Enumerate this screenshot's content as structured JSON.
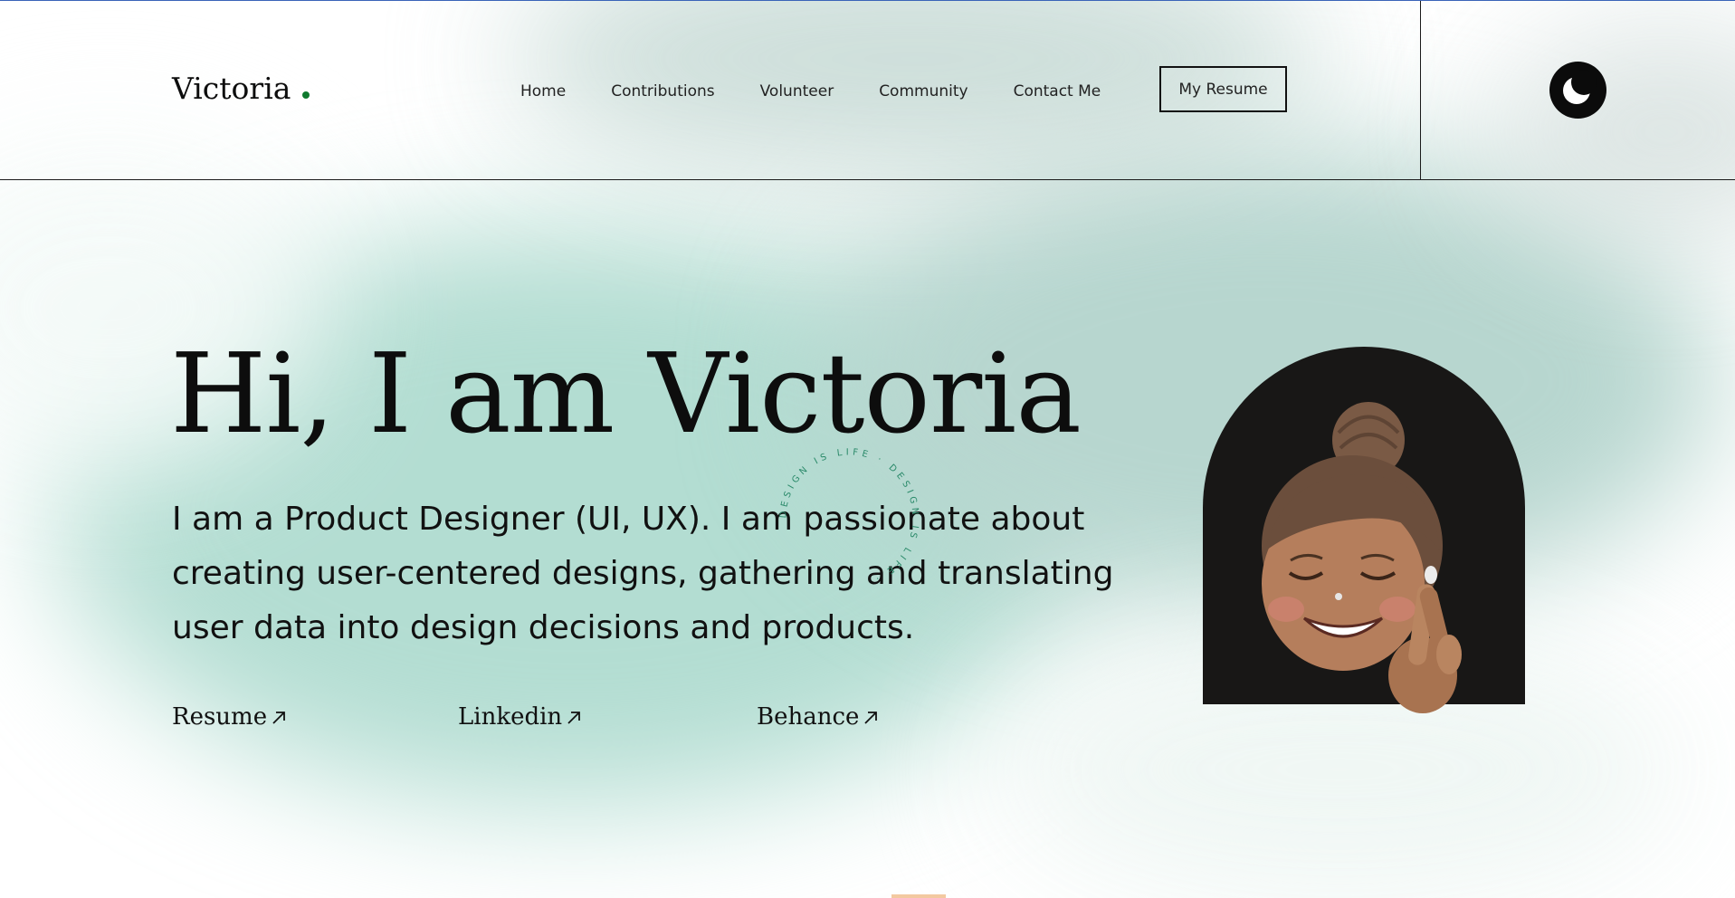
{
  "header": {
    "logo": "Victoria",
    "nav": [
      "Home",
      "Contributions",
      "Volunteer",
      "Community",
      "Contact Me"
    ],
    "resume_button": "My Resume",
    "theme_toggle_icon": "moon-icon"
  },
  "hero": {
    "title": "Hi, I am Victoria",
    "description": "I am a Product Designer (UI, UX). I am passionate about creating user-centered designs, gathering and translating user data into design decisions and products.",
    "badge_text": "DESIGN IS LIFE · DESIGN IS LIFE ·",
    "links": [
      {
        "label": "Resume",
        "icon": "arrow-up-right-icon"
      },
      {
        "label": "Linkedin",
        "icon": "arrow-up-right-icon"
      },
      {
        "label": "Behance",
        "icon": "arrow-up-right-icon"
      }
    ],
    "avatar_icon": "memoji-avatar"
  },
  "colors": {
    "accent_dot": "#0f7a2e",
    "background_mint": "#b3ddd2",
    "text": "#0d0d0d",
    "avatar_bg": "#181716",
    "badge_text": "#2b8a6a"
  }
}
